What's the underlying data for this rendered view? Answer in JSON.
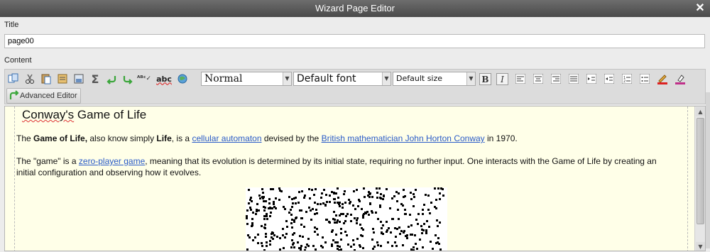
{
  "window": {
    "title": "Wizard Page Editor"
  },
  "form": {
    "title_label": "Title",
    "title_value": "page00",
    "content_label": "Content"
  },
  "toolbar": {
    "format_select": "Normal",
    "font_select": "Default font",
    "size_select": "Default size",
    "bold": "B",
    "italic": "I",
    "advanced_editor": "Advanced Editor"
  },
  "document": {
    "heading": "Conway's Game of Life",
    "p1": {
      "t1": "The ",
      "b1": "Game of Life,",
      "t2": " also know simply ",
      "b2": "Life",
      "t3": ", is a ",
      "l1": "cellular automaton",
      "t4": " devised by the ",
      "l2": "British mathematician John Horton Conway",
      "t5": " in 1970."
    },
    "p2": {
      "t1": "The \"game\" is a ",
      "l1": "zero-player game",
      "t2": ", meaning that its evolution is determined by its initial state, requiring no further input. One interacts with the Game of Life by creating an initial configuration and observing how it evolves."
    }
  },
  "icons": [
    "copy-icon",
    "cut-icon",
    "paste-icon",
    "paste-text-icon",
    "paste-word-icon",
    "sum-icon",
    "undo-icon",
    "redo-icon",
    "spellcheck-icon",
    "spellcheck-abc-icon",
    "web-icon",
    "bold-icon",
    "italic-icon",
    "align-left-icon",
    "align-center-icon",
    "align-right-icon",
    "justify-icon",
    "indent-icon",
    "outdent-icon",
    "ordered-list-icon",
    "unordered-list-icon",
    "text-color-icon",
    "highlight-icon"
  ],
  "colors": {
    "titlebar": "#555555",
    "link": "#2a5bc7",
    "editor_bg": "#ffffe8",
    "undo_green": "#3aa63a"
  }
}
